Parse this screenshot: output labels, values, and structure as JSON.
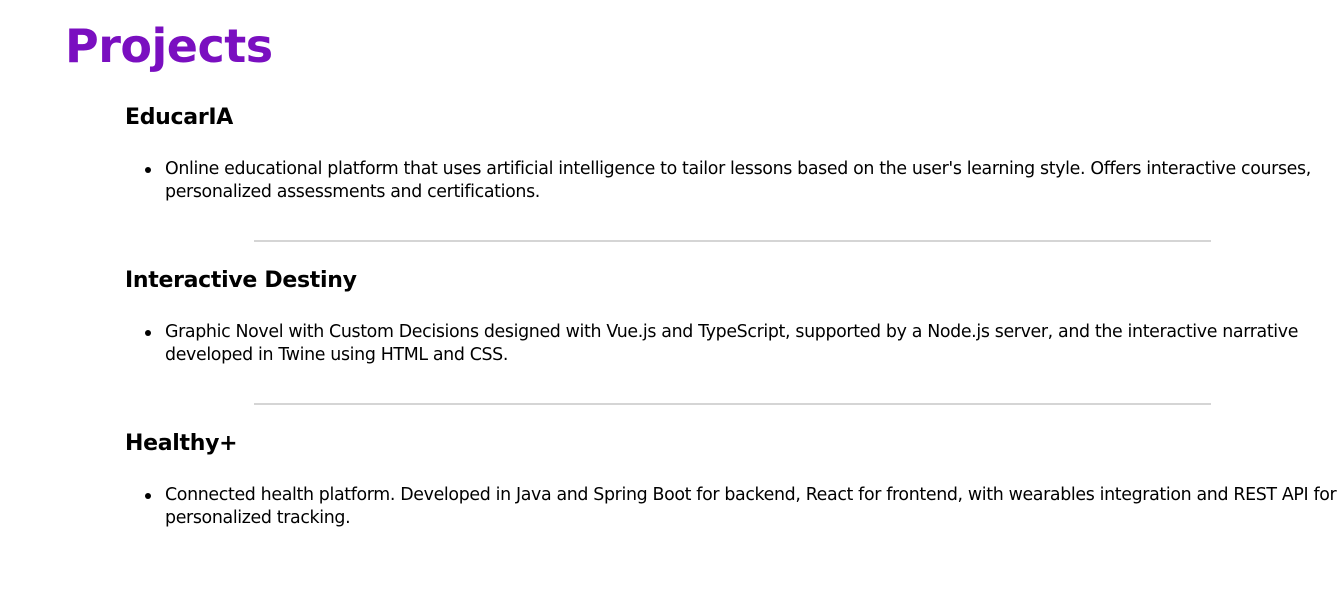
{
  "page": {
    "title": "Projects"
  },
  "projects": [
    {
      "name": "EducarIA",
      "description": "Online educational platform that uses artificial intelligence to tailor lessons based on the user's learning style. Offers interactive courses, personalized assessments and certifications."
    },
    {
      "name": "Interactive Destiny",
      "description": "Graphic Novel with Custom Decisions designed with Vue.js and TypeScript, supported by a Node.js server, and the interactive narrative developed in Twine using HTML and CSS."
    },
    {
      "name": "Healthy+",
      "description": "Connected health platform. Developed in Java and Spring Boot for backend, React for frontend, with wearables integration and REST API for personalized tracking."
    }
  ],
  "colors": {
    "title": "#7a0fc0",
    "text": "#000000",
    "divider": "#d5d5d5",
    "background": "#ffffff"
  }
}
